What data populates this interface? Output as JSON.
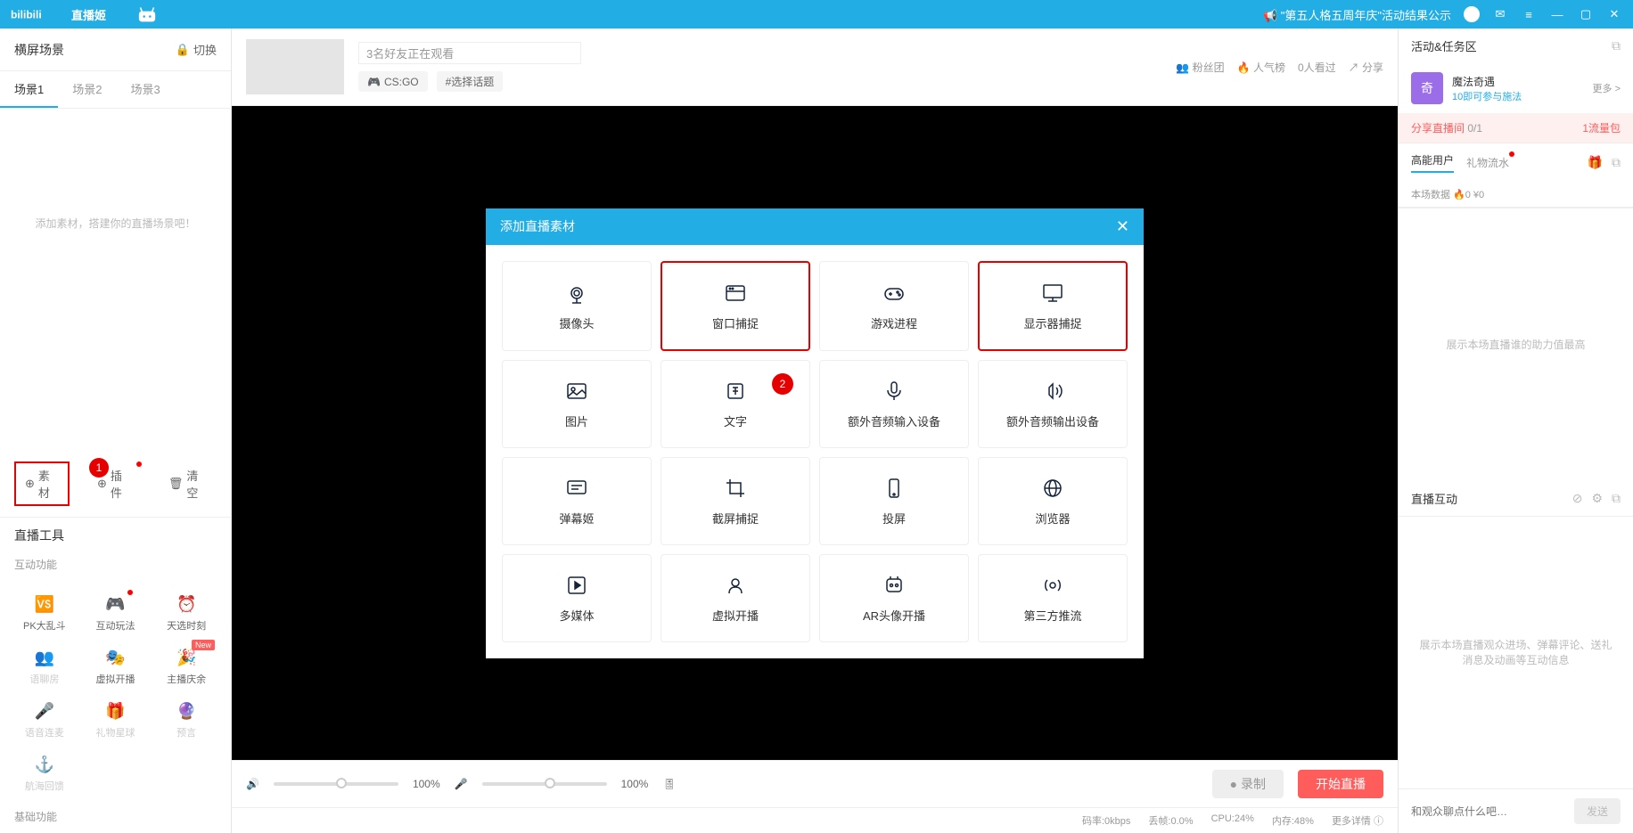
{
  "titlebar": {
    "product": "直播姬",
    "announcement": "\"第五人格五周年庆\"活动结果公示"
  },
  "sidebar": {
    "scene_header": "横屏场景",
    "switch_label": "切换",
    "tabs": [
      "场景1",
      "场景2",
      "场景3"
    ],
    "placeholder": "添加素材，搭建你的直播场景吧！",
    "material_btn": "素材",
    "plugin_btn": "插件",
    "clear_btn": "清空",
    "tool_header": "直播工具",
    "subsection_interaction": "互动功能",
    "subsection_basic": "基础功能",
    "tools": [
      {
        "label": "PK大乱斗",
        "disabled": false
      },
      {
        "label": "互动玩法",
        "disabled": false,
        "dot": true
      },
      {
        "label": "天选时刻",
        "disabled": false
      },
      {
        "label": "语聊房",
        "disabled": true
      },
      {
        "label": "虚拟开播",
        "disabled": false
      },
      {
        "label": "主播庆余",
        "disabled": false,
        "new": true
      },
      {
        "label": "语音连麦",
        "disabled": true
      },
      {
        "label": "礼物星球",
        "disabled": true
      },
      {
        "label": "预言",
        "disabled": true
      },
      {
        "label": "航海回馈",
        "disabled": true
      }
    ]
  },
  "center": {
    "title_input": "3名好友正在观看",
    "tag_game": "CS:GO",
    "tag_topic": "#选择话题",
    "action_fans": "粉丝团",
    "action_rank": "人气榜",
    "action_views": "0人看过",
    "action_share": "分享",
    "volume_pct": "100%",
    "record_btn": "录制",
    "start_btn": "开始直播",
    "status_rate": "码率:0kbps",
    "status_drop": "丢帧:0.0%",
    "status_cpu": "CPU:24%",
    "status_mem": "内存:48%",
    "status_more": "更多详情"
  },
  "right": {
    "header": "活动&任务区",
    "event_icon_text": "奇",
    "event_title": "魔法奇遇",
    "event_sub": "10即可参与施法",
    "event_more": "更多 >",
    "banner_left": "分享直播间",
    "banner_progress": "0/1",
    "banner_right": "1流量包",
    "tab_users": "高能用户",
    "tab_gifts": "礼物流水",
    "stats": "本场数据  🔥0  ¥0",
    "empty_users": "展示本场直播谁的助力值最高",
    "section_interaction": "直播互动",
    "empty_chat": "展示本场直播观众进场、弹幕评论、送礼消息及动画等互动信息",
    "chat_placeholder": "和观众聊点什么吧…",
    "chat_send": "发送"
  },
  "modal": {
    "title": "添加直播素材",
    "items": [
      {
        "label": "摄像头",
        "icon": "camera"
      },
      {
        "label": "窗口捕捉",
        "icon": "window",
        "highlighted": true
      },
      {
        "label": "游戏进程",
        "icon": "gamepad"
      },
      {
        "label": "显示器捕捉",
        "icon": "monitor",
        "highlighted": true
      },
      {
        "label": "图片",
        "icon": "image"
      },
      {
        "label": "文字",
        "icon": "text",
        "badge": "2"
      },
      {
        "label": "额外音频输入设备",
        "icon": "mic"
      },
      {
        "label": "额外音频输出设备",
        "icon": "speaker"
      },
      {
        "label": "弹幕姬",
        "icon": "danmaku"
      },
      {
        "label": "截屏捕捉",
        "icon": "crop"
      },
      {
        "label": "投屏",
        "icon": "phone"
      },
      {
        "label": "浏览器",
        "icon": "browser"
      },
      {
        "label": "多媒体",
        "icon": "media"
      },
      {
        "label": "虚拟开播",
        "icon": "virtual"
      },
      {
        "label": "AR头像开播",
        "icon": "ar"
      },
      {
        "label": "第三方推流",
        "icon": "stream"
      }
    ]
  },
  "annotations": {
    "badge1": "1"
  }
}
